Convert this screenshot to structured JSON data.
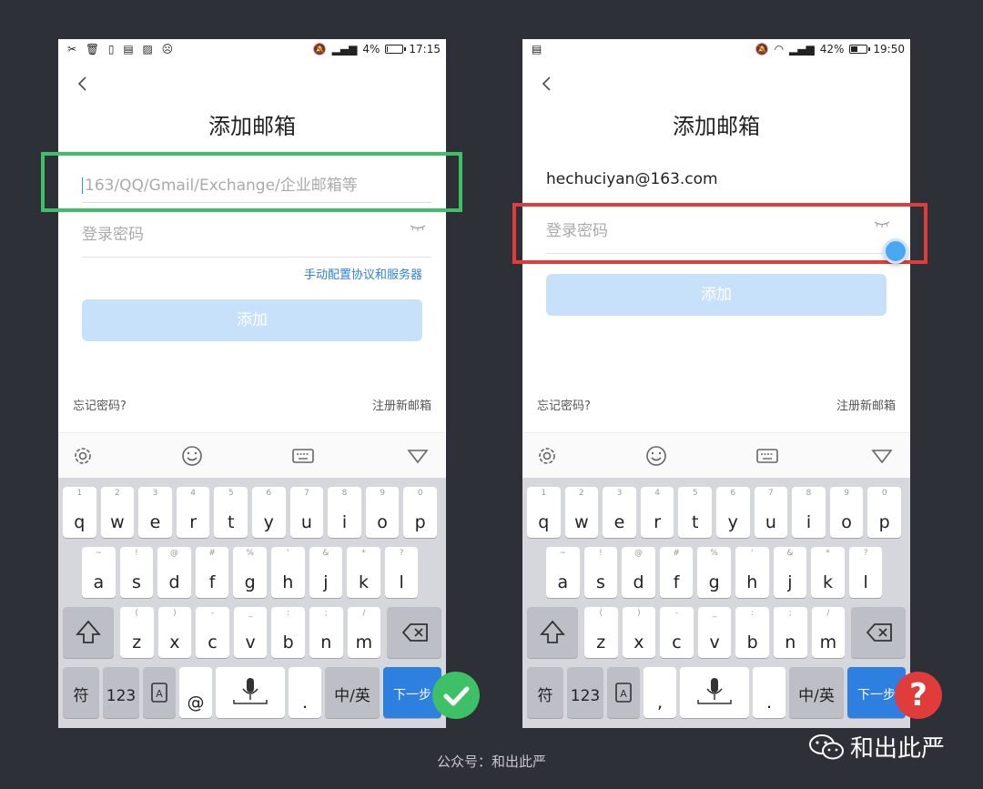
{
  "left_phone": {
    "status": {
      "icons_left": "✂ 🗑 ▯ ▤ ▨ ☹",
      "battery": "4%",
      "time": "17:15"
    },
    "title": "添加邮箱",
    "email_placeholder": "163/QQ/Gmail/Exchange/企业邮箱等",
    "password_placeholder": "登录密码",
    "manual_config_link": "手动配置协议和服务器",
    "add_button": "添加",
    "forgot_password": "忘记密码?",
    "register": "注册新邮箱",
    "battery_level": 0.04
  },
  "right_phone": {
    "status": {
      "icons_left": "▤",
      "battery": "42%",
      "time": "19:50"
    },
    "title": "添加邮箱",
    "email_value": "hechuciyan@163.com",
    "password_placeholder": "登录密码",
    "add_button": "添加",
    "forgot_password": "忘记密码?",
    "register": "注册新邮箱",
    "battery_level": 0.42
  },
  "keyboard": {
    "row1": [
      {
        "hint": "1",
        "label": "q"
      },
      {
        "hint": "2",
        "label": "w"
      },
      {
        "hint": "3",
        "label": "e"
      },
      {
        "hint": "4",
        "label": "r"
      },
      {
        "hint": "5",
        "label": "t"
      },
      {
        "hint": "6",
        "label": "y"
      },
      {
        "hint": "7",
        "label": "u"
      },
      {
        "hint": "8",
        "label": "i"
      },
      {
        "hint": "9",
        "label": "o"
      },
      {
        "hint": "0",
        "label": "p"
      }
    ],
    "row2": [
      {
        "hint": "~",
        "label": "a"
      },
      {
        "hint": "!",
        "label": "s"
      },
      {
        "hint": "@",
        "label": "d"
      },
      {
        "hint": "#",
        "label": "f"
      },
      {
        "hint": "%",
        "label": "g"
      },
      {
        "hint": "'",
        "label": "h"
      },
      {
        "hint": "&",
        "label": "j"
      },
      {
        "hint": "*",
        "label": "k"
      },
      {
        "hint": "?",
        "label": "l"
      }
    ],
    "row3": [
      {
        "hint": "(",
        "label": "z"
      },
      {
        "hint": ")",
        "label": "x"
      },
      {
        "hint": "-",
        "label": "c"
      },
      {
        "hint": "_",
        "label": "v"
      },
      {
        "hint": ":",
        "label": "b"
      },
      {
        "hint": ";",
        "label": "n"
      },
      {
        "hint": "/",
        "label": "m"
      }
    ],
    "symbol_key": "符",
    "numeric_key": "123",
    "left_at_key": "@",
    "right_comma_key": ",",
    "period_key": ".",
    "lang_key": "中/英",
    "next_key": "下一步"
  },
  "footer_caption": "公众号：和出此严",
  "watermark_text": "和出此严",
  "colors": {
    "good": "#3ec166",
    "bad": "#e03c3c",
    "accent": "#2d7fe0"
  }
}
